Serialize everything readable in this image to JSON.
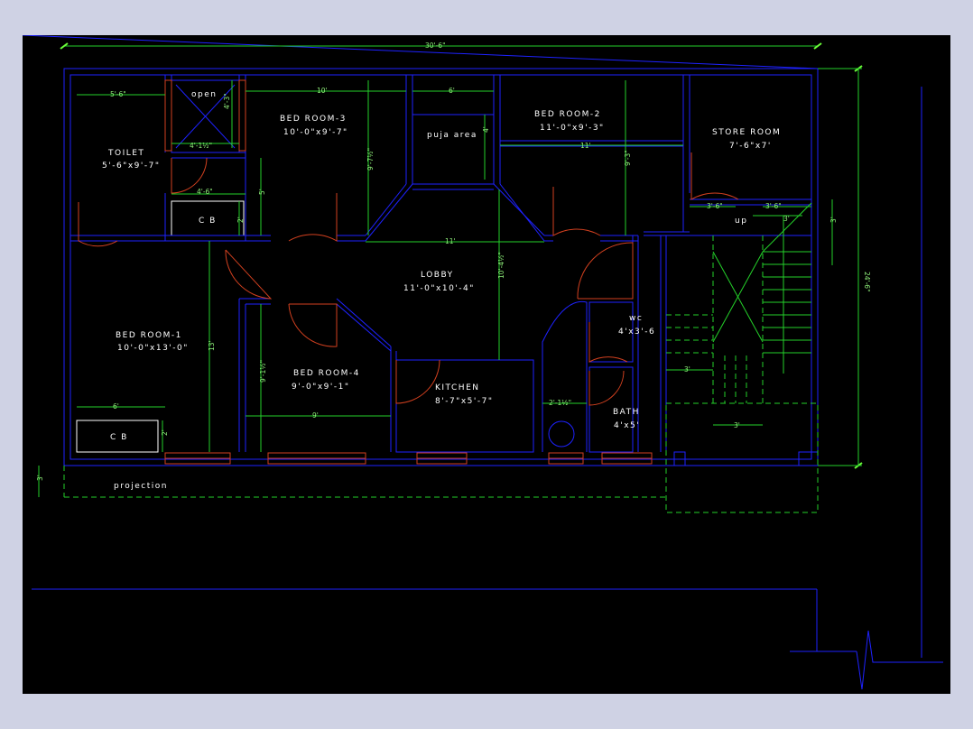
{
  "colors": {
    "background": "#000000",
    "frame": "#cfd2e4",
    "walls": "#1e22ff",
    "dimensions": "#24d12a",
    "doors": "#d2401f",
    "text": "#ffffff"
  },
  "rooms": {
    "toilet": {
      "name": "TOILET",
      "size": "5'-6\"x9'-7\""
    },
    "open": {
      "name": "open"
    },
    "bed3": {
      "name": "BED ROOM-3",
      "size": "10'-0\"x9'-7\""
    },
    "puja": {
      "name": "puja area"
    },
    "bed2": {
      "name": "BED ROOM-2",
      "size": "11'-0\"x9'-3\""
    },
    "store": {
      "name": "STORE ROOM",
      "size": "7'-6\"x7'"
    },
    "cb1": {
      "name": "C B"
    },
    "up": {
      "name": "up"
    },
    "lobby": {
      "name": "LOBBY",
      "size": "11'-0\"x10'-4\""
    },
    "bed1": {
      "name": "BED ROOM-1",
      "size": "10'-0\"x13'-0\""
    },
    "wc": {
      "name": "wc",
      "size": "4'x3'-6"
    },
    "bed4": {
      "name": "BED ROOM-4",
      "size": "9'-0\"x9'-1\""
    },
    "kitchen": {
      "name": "KITCHEN",
      "size": "8'-7\"x5'-7\""
    },
    "bath": {
      "name": "BATH",
      "size": "4'x5'"
    },
    "cb2": {
      "name": "C B"
    },
    "projection": {
      "name": "projection"
    }
  },
  "dimensions": {
    "overall_width": "30'-6\"",
    "overall_depth": "24'-6\"",
    "toilet_width": "5'-6\"",
    "open_depth": "4'-3\"",
    "open_width": "4'-1½\"",
    "cb_width": "4'-6\"",
    "cb_depth": "2'",
    "toilet_depth": "5'",
    "bed3_width": "10'",
    "bed3_depth": "9'-7½\"",
    "puja_width": "6'",
    "puja_depth": "4'",
    "bed2_depth": "9'-3\"",
    "bed2_width": "11'",
    "lobby_width": "11'",
    "lobby_depth": "10'-4½\"",
    "stair_left": "3'-6\"",
    "stair_right": "3'-6\"",
    "stair_rise": "3'",
    "stair_side": "3'",
    "bed1_depth": "13'",
    "bed1_cb_width": "6'",
    "cb2_depth": "2'",
    "bed4_depth": "9'-1½\"",
    "bed4_width": "9'",
    "wc_gap": "3'",
    "stair_bottom": "3'",
    "bath_tap": "2'-1½\"",
    "projection_depth": "3'"
  }
}
